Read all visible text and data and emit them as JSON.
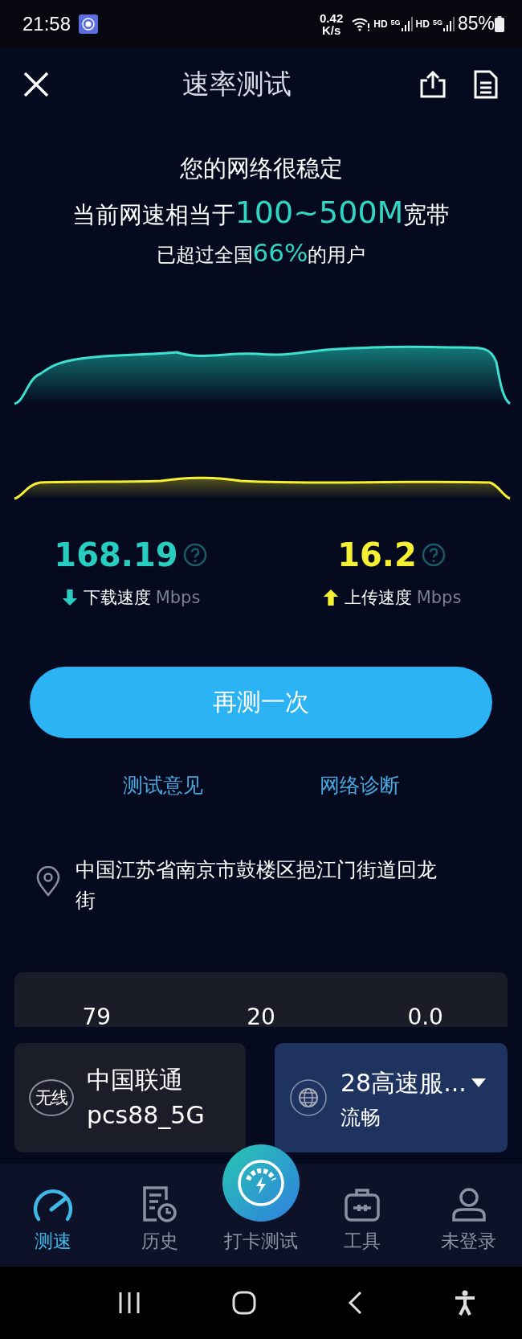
{
  "status_bar": {
    "time": "21:58",
    "net_speed": "0.42",
    "net_unit": "K/s",
    "indicators": [
      {
        "kind": "hd",
        "text": "HD"
      },
      {
        "kind": "signal",
        "text": "5G"
      },
      {
        "kind": "hd",
        "text": "HD"
      },
      {
        "kind": "signal",
        "text": "5G"
      }
    ],
    "battery": "85%"
  },
  "header": {
    "title": "速率测试"
  },
  "summary": {
    "headline": "您的网络很稳定",
    "speed_line": "当前网速相当于**100~500M**宽带",
    "rank_line": "已超过全国**66%**的用户"
  },
  "results": [
    {
      "kind": "download",
      "value": "168.19",
      "label": "下载速度",
      "unit": "Mbps"
    },
    {
      "kind": "upload",
      "value": "16.2",
      "label": "上传速度",
      "unit": "Mbps"
    }
  ],
  "retest_button": "再测一次",
  "links": [
    "测试意见",
    "网络诊断"
  ],
  "location": "中国江苏省南京市鼓楼区挹江门街道回龙街",
  "stats": [
    "79",
    "20",
    "0.0"
  ],
  "network_card": {
    "badge": "无线",
    "carrier": "中国联通",
    "ssid": "pcs88_5G"
  },
  "server_card": {
    "name": "28高速服...",
    "quality": "流畅"
  },
  "nav": [
    {
      "kind": "speed",
      "label": "测速",
      "selected": true
    },
    {
      "kind": "history",
      "label": "历史",
      "selected": false
    },
    {
      "kind": "checkin",
      "label": "打卡测试",
      "selected": false
    },
    {
      "kind": "tools",
      "label": "工具",
      "selected": false
    },
    {
      "kind": "account",
      "label": "未登录",
      "selected": false
    }
  ]
}
